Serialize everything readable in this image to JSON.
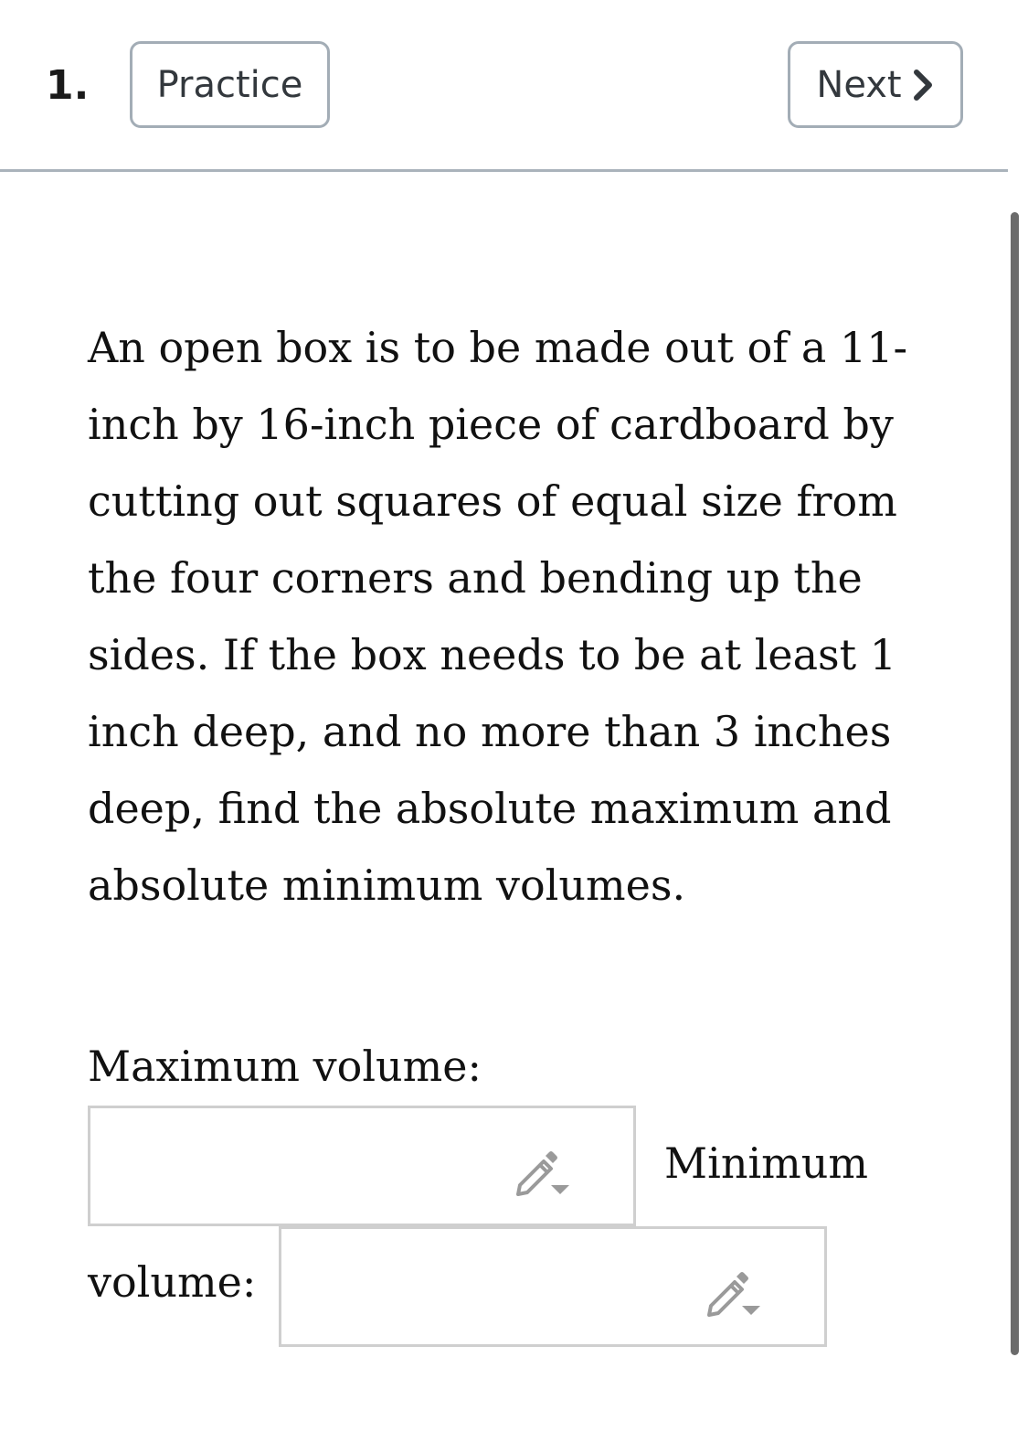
{
  "header": {
    "question_number": "1.",
    "practice_label": "Practice",
    "next_label": "Next"
  },
  "problem": {
    "text": "An open box is to be made out of a 11-inch by 16-inch piece of cardboard by cutting out squares of equal size from the four corners and bending up the sides. If the box needs to be at least 1 inch deep, and no more than 3 inches deep, find the absolute maximum and absolute minimum volumes."
  },
  "answers": {
    "max_label": "Maximum volume:",
    "min_label_part1": "Minimum",
    "min_label_part2": "volume:",
    "max_value": "",
    "min_value": ""
  },
  "icons": {
    "pencil": "pencil-icon",
    "dropdown": "caret-down-icon",
    "next": "chevron-right-icon"
  },
  "colors": {
    "button_border": "#a3adb6",
    "divider": "#aab3bb",
    "input_border": "#cfcfcf",
    "icon_gray": "#9a9a9a"
  }
}
